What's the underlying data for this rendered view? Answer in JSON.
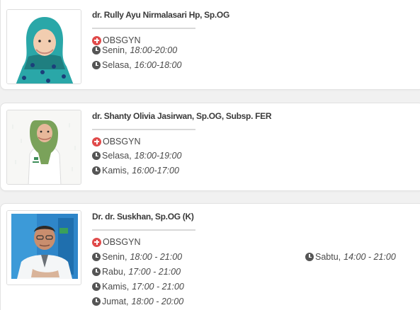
{
  "doctors": [
    {
      "name": "dr. Rully Ayu Nirmalasari Hp, Sp.OG",
      "specialty": "OBSGYN",
      "schedule": [
        {
          "day": "Senin,",
          "time": "18:00-20:00"
        },
        {
          "day": "Selasa,",
          "time": "16:00-18:00"
        }
      ]
    },
    {
      "name": "dr. Shanty Olivia Jasirwan, Sp.OG, Subsp. FER",
      "specialty": "OBSGYN",
      "schedule": [
        {
          "day": "Selasa,",
          "time": "18:00-19:00"
        },
        {
          "day": "Kamis,",
          "time": "16:00-17:00"
        }
      ]
    },
    {
      "name": "Dr. dr. Suskhan, Sp.OG (K)",
      "specialty": "OBSGYN",
      "schedule": [
        {
          "day": "Senin,",
          "time": "18:00 - 21:00"
        },
        {
          "day": "Sabtu,",
          "time": "14:00 - 21:00"
        },
        {
          "day": "Rabu,",
          "time": "17:00 - 21:00"
        },
        {
          "day": "Kamis,",
          "time": "17:00 - 21:00"
        },
        {
          "day": "Jumat,",
          "time": "18:00 - 20:00"
        }
      ]
    }
  ],
  "icons": {
    "specialty": "plus-circle-icon",
    "schedule": "clock-icon"
  },
  "colors": {
    "specialty_icon": "#e04b4b",
    "clock_icon": "#555555",
    "hijab_teal": "#2aa7a8",
    "hijab_green": "#7aa25a",
    "coat_green": "#3e8e5a"
  }
}
